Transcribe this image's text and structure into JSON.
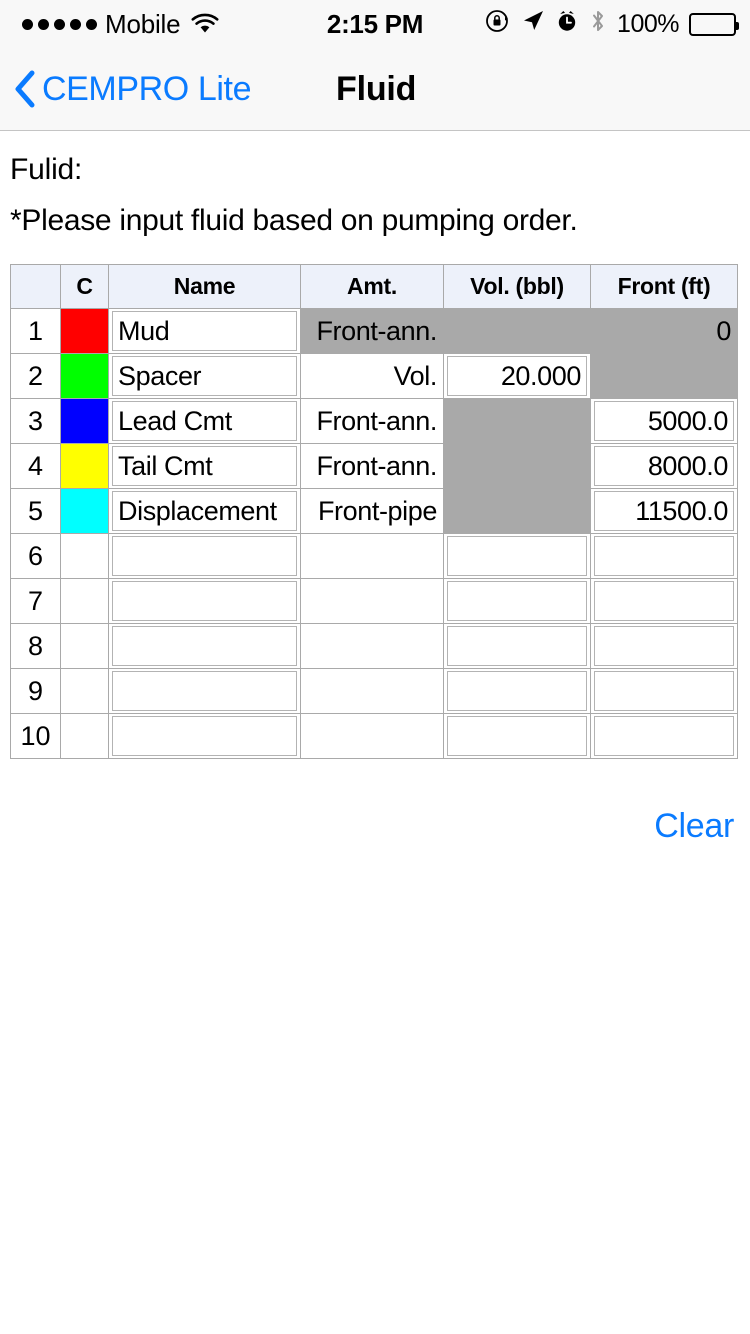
{
  "status_bar": {
    "signal_dots": 5,
    "carrier": "Mobile",
    "wifi_icon": "wifi-icon",
    "time": "2:15 PM",
    "icons": [
      "rotation-lock-icon",
      "location-arrow-icon",
      "alarm-clock-icon",
      "bluetooth-icon"
    ],
    "battery_percent": "100%",
    "battery_level": 100
  },
  "nav": {
    "back_icon": "chevron-left-icon",
    "back_label": "CEMPRO Lite",
    "title": "Fluid",
    "accent_color": "#0a7bff"
  },
  "content": {
    "section_label": "Fulid:",
    "note": "*Please input fluid based on pumping order."
  },
  "table": {
    "headers": [
      "",
      "C",
      "Name",
      "Amt.",
      "Vol. (bbl)",
      "Front (ft)"
    ],
    "rows": [
      {
        "index": "1",
        "color": "#FF0000",
        "name": "Mud",
        "amt": "Front-ann.",
        "amt_disabled": true,
        "vol": "",
        "vol_disabled": true,
        "front": "0",
        "front_disabled": true
      },
      {
        "index": "2",
        "color": "#00FF00",
        "name": "Spacer",
        "amt": "Vol.",
        "amt_disabled": false,
        "vol": "20.000",
        "vol_disabled": false,
        "front": "",
        "front_disabled": true
      },
      {
        "index": "3",
        "color": "#0000FF",
        "name": "Lead Cmt",
        "amt": "Front-ann.",
        "amt_disabled": false,
        "vol": "",
        "vol_disabled": true,
        "front": "5000.0",
        "front_disabled": false
      },
      {
        "index": "4",
        "color": "#FFFF00",
        "name": "Tail Cmt",
        "amt": "Front-ann.",
        "amt_disabled": false,
        "vol": "",
        "vol_disabled": true,
        "front": "8000.0",
        "front_disabled": false
      },
      {
        "index": "5",
        "color": "#00FFFF",
        "name": "Displacement",
        "amt": "Front-pipe",
        "amt_disabled": false,
        "vol": "",
        "vol_disabled": true,
        "front": "11500.0",
        "front_disabled": false
      },
      {
        "index": "6",
        "color": "",
        "name": "",
        "amt": "",
        "amt_disabled": false,
        "vol": "",
        "vol_disabled": false,
        "front": "",
        "front_disabled": false
      },
      {
        "index": "7",
        "color": "",
        "name": "",
        "amt": "",
        "amt_disabled": false,
        "vol": "",
        "vol_disabled": false,
        "front": "",
        "front_disabled": false
      },
      {
        "index": "8",
        "color": "",
        "name": "",
        "amt": "",
        "amt_disabled": false,
        "vol": "",
        "vol_disabled": false,
        "front": "",
        "front_disabled": false
      },
      {
        "index": "9",
        "color": "",
        "name": "",
        "amt": "",
        "amt_disabled": false,
        "vol": "",
        "vol_disabled": false,
        "front": "",
        "front_disabled": false
      },
      {
        "index": "10",
        "color": "",
        "name": "",
        "amt": "",
        "amt_disabled": false,
        "vol": "",
        "vol_disabled": false,
        "front": "",
        "front_disabled": false
      }
    ]
  },
  "actions": {
    "clear_label": "Clear"
  }
}
